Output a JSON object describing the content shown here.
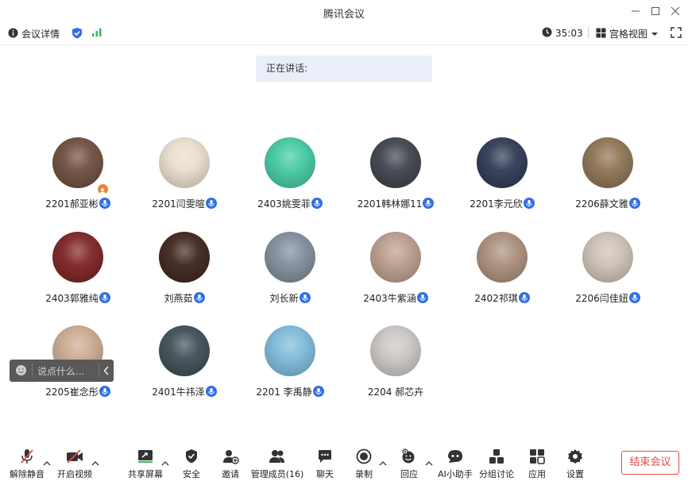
{
  "window": {
    "title": "腾讯会议"
  },
  "infobar": {
    "meeting_details": "会议详情",
    "timer": "35:03",
    "view_mode": "宫格视图"
  },
  "speaking": {
    "label": "正在讲话:"
  },
  "participants": [
    {
      "name": "2201郝亚彬",
      "mic": true,
      "host": true,
      "color": "#6b4a3a"
    },
    {
      "name": "2201闫雯暄",
      "mic": true,
      "host": false,
      "color": "#e8dccb"
    },
    {
      "name": "2403姚雯菲",
      "mic": true,
      "host": false,
      "color": "#3fc7a0"
    },
    {
      "name": "2201韩林娜11",
      "mic": true,
      "host": false,
      "color": "#3a3f48"
    },
    {
      "name": "2201李元欣",
      "mic": true,
      "host": false,
      "color": "#2a3550"
    },
    {
      "name": "2206薛文雅",
      "mic": true,
      "host": false,
      "color": "#8a7050"
    },
    {
      "name": "2403郭雅纯",
      "mic": true,
      "host": false,
      "color": "#7a1e1e"
    },
    {
      "name": "刘燕茹",
      "mic": true,
      "host": false,
      "color": "#3a2018"
    },
    {
      "name": "刘长新",
      "mic": true,
      "host": false,
      "color": "#7d8a9a"
    },
    {
      "name": "2403牛紫涵",
      "mic": true,
      "host": false,
      "color": "#b89a8a"
    },
    {
      "name": "2402祁琪",
      "mic": true,
      "host": false,
      "color": "#a88c78"
    },
    {
      "name": "2206闫佳妞",
      "mic": true,
      "host": false,
      "color": "#cbbfb2"
    },
    {
      "name": "2205崔念彤",
      "mic": true,
      "host": false,
      "color": "#c9a88e"
    },
    {
      "name": "2401牛祎泽",
      "mic": true,
      "host": false,
      "color": "#3a4a52"
    },
    {
      "name": "2201 李禹静",
      "mic": true,
      "host": false,
      "color": "#7ab8d8"
    },
    {
      "name": "2204 郝芯卉",
      "mic": false,
      "host": false,
      "color": "#c8c4c2"
    }
  ],
  "chat": {
    "placeholder": "说点什么..."
  },
  "toolbar": {
    "unmute": "解除静音",
    "start_video": "开启视频",
    "share_screen": "共享屏幕",
    "security": "安全",
    "invite": "邀请",
    "manage_members": "管理成员(16)",
    "chat": "聊天",
    "record": "录制",
    "react": "回应",
    "ai_assistant": "AI小助手",
    "breakout": "分组讨论",
    "apps": "应用",
    "settings": "设置",
    "end_meeting": "结束会议"
  }
}
